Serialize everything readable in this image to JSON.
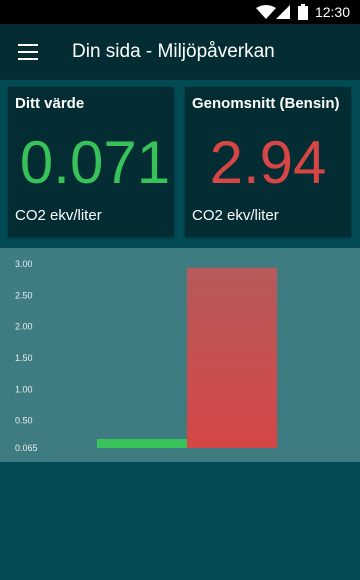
{
  "status_bar": {
    "time": "12:30",
    "icons": [
      "wifi-icon",
      "signal-icon",
      "battery-icon"
    ]
  },
  "app_bar": {
    "title": "Din sida - Miljöpåverkan",
    "menu_icon": "menu-icon"
  },
  "cards": [
    {
      "title": "Ditt värde",
      "value": "0.071",
      "unit": "CO2 ekv/liter",
      "color": "#37c25a"
    },
    {
      "title": "Genomsnitt (Bensin)",
      "value": "2.94",
      "unit": "CO2 ekv/liter",
      "color": "#d64646"
    }
  ],
  "colors": {
    "background": "#024b55",
    "app_bar": "#032d33",
    "chart_background": "#3f7c82"
  },
  "chart_data": {
    "type": "bar",
    "categories": [
      "Ditt värde",
      "Genomsnitt (Bensin)"
    ],
    "values": [
      0.071,
      2.94
    ],
    "bar_colors": [
      "#37c25a",
      "#d64646"
    ],
    "ytick_labels": [
      "3.00",
      "2.50",
      "2.00",
      "1.50",
      "1.00",
      "0.50",
      "0.065"
    ],
    "ytick_values": [
      3.0,
      2.5,
      2.0,
      1.5,
      1.0,
      0.5,
      0.065
    ],
    "ylim": [
      0.065,
      3.0
    ],
    "grid": false,
    "title": "",
    "xlabel": "",
    "ylabel": ""
  }
}
